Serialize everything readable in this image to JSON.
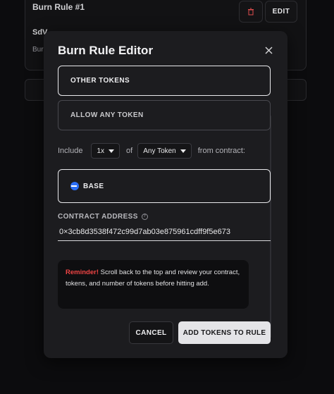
{
  "background": {
    "rule_title": "Burn Rule #1",
    "edit_label": "EDIT",
    "line2_text": "SdV",
    "line3_text": "Bur"
  },
  "modal": {
    "title": "Burn Rule Editor",
    "options": {
      "other_tokens": "OTHER TOKENS",
      "allow_any": "ALLOW ANY TOKEN"
    },
    "include_row": {
      "include_label": "Include",
      "quantity_value": "1x",
      "of_label": "of",
      "token_value": "Any Token",
      "from_label": "from contract:"
    },
    "chain": {
      "label": "BASE",
      "icon": "base-chain-icon",
      "icon_color": "#2b6ef5"
    },
    "contract": {
      "label": "CONTRACT ADDRESS",
      "value": "0×3cb8d3538f472c99d7ab03e875961cdff9f5e673"
    },
    "reminder": {
      "prefix": "Reminder!",
      "text": "Scroll back to the top and review your contract, tokens, and number of tokens before hitting add."
    },
    "buttons": {
      "cancel": "CANCEL",
      "add": "ADD TOKENS TO RULE"
    }
  },
  "colors": {
    "accent_reminder": "#ef4444",
    "primary_button_bg": "#e4e4e7",
    "modal_bg": "#1c1c1f"
  }
}
